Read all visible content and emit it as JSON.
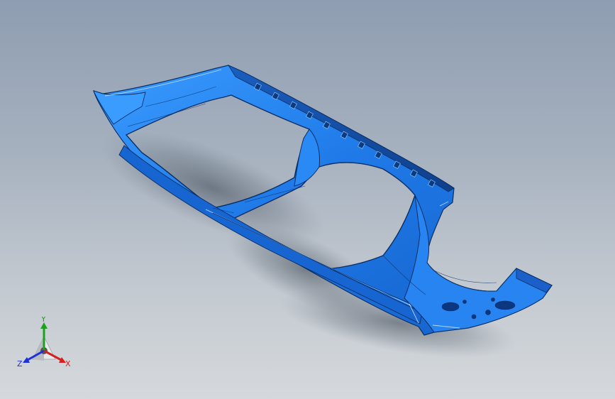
{
  "graphics_area": {
    "model": {
      "icon": "sheet-metal-body-frame",
      "color": "#1e78e6",
      "edge_color": "#0a2e66"
    },
    "axis_triad": {
      "x": {
        "label": "X",
        "color": "#d42020"
      },
      "y": {
        "label": "Y",
        "color": "#1ea01e"
      },
      "z": {
        "label": "Z",
        "color": "#2030d8"
      }
    }
  }
}
